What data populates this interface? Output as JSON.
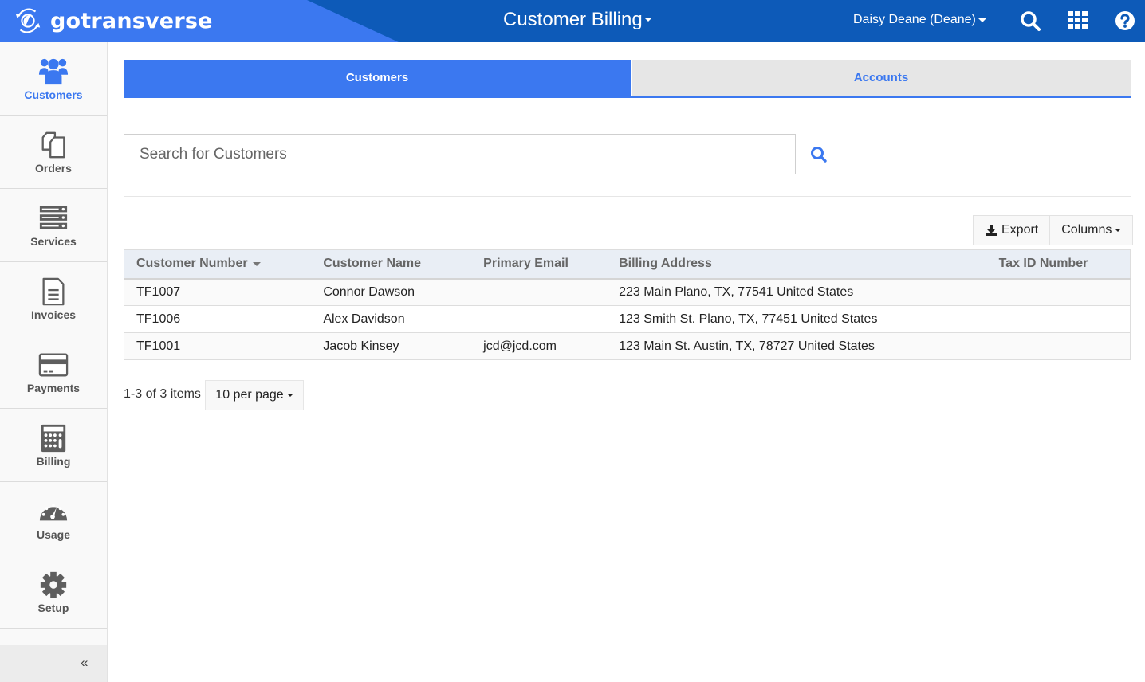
{
  "header": {
    "brand": "gotransverse",
    "app_title": "Customer Billing",
    "user": "Daisy Deane (Deane)",
    "icons": [
      "search-icon",
      "apps-grid-icon",
      "help-icon"
    ],
    "colors": {
      "bar": "#0d5ab8",
      "brand_panel": "#3b78f0"
    }
  },
  "sidebar": {
    "items": [
      {
        "label": "Customers",
        "icon": "users-icon",
        "active": true
      },
      {
        "label": "Orders",
        "icon": "documents-icon",
        "active": false
      },
      {
        "label": "Services",
        "icon": "server-icon",
        "active": false
      },
      {
        "label": "Invoices",
        "icon": "invoice-icon",
        "active": false
      },
      {
        "label": "Payments",
        "icon": "credit-card-icon",
        "active": false
      },
      {
        "label": "Billing",
        "icon": "calculator-icon",
        "active": false
      },
      {
        "label": "Usage",
        "icon": "gauge-icon",
        "active": false
      },
      {
        "label": "Setup",
        "icon": "gear-icon",
        "active": false
      }
    ],
    "collapse_label": "«"
  },
  "tabs": [
    {
      "label": "Customers",
      "active": true
    },
    {
      "label": "Accounts",
      "active": false
    }
  ],
  "search": {
    "value": "",
    "placeholder": "Search for Customers"
  },
  "toolbar": {
    "export_label": "Export",
    "columns_label": "Columns"
  },
  "table": {
    "columns": [
      "Customer Number",
      "Customer Name",
      "Primary Email",
      "Billing Address",
      "Tax ID Number"
    ],
    "sorted_column": "Customer Number",
    "sort_direction": "descending",
    "rows": [
      [
        "TF1007",
        "Connor Dawson",
        "",
        "223 Main Plano, TX, 77541 United States",
        ""
      ],
      [
        "TF1006",
        "Alex Davidson",
        "",
        "123 Smith St. Plano, TX, 77451 United States",
        ""
      ],
      [
        "TF1001",
        "Jacob Kinsey",
        "jcd@jcd.com",
        "123 Main St. Austin, TX, 78727 United States",
        ""
      ]
    ]
  },
  "pager": {
    "info": "1-3 of 3 items",
    "per_page": "10 per page"
  },
  "colors": {
    "accent": "#3b78f0",
    "header_row": "#e9eef5",
    "sidebar_text": "#555555"
  }
}
